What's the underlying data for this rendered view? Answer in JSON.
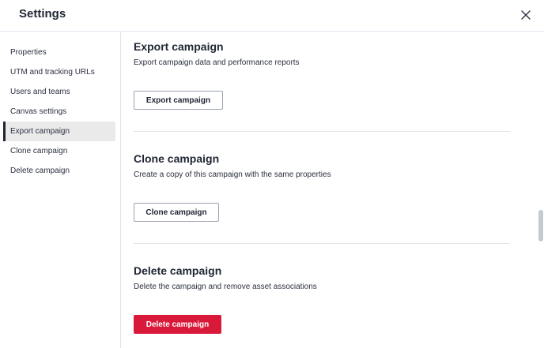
{
  "header": {
    "title": "Settings",
    "close_icon": "close-icon"
  },
  "sidebar": {
    "items": [
      {
        "label": "Properties",
        "active": false
      },
      {
        "label": "UTM and tracking URLs",
        "active": false
      },
      {
        "label": "Users and teams",
        "active": false
      },
      {
        "label": "Canvas settings",
        "active": false
      },
      {
        "label": "Export campaign",
        "active": true
      },
      {
        "label": "Clone campaign",
        "active": false
      },
      {
        "label": "Delete campaign",
        "active": false
      }
    ]
  },
  "sections": {
    "export": {
      "title": "Export campaign",
      "description": "Export campaign data and performance reports",
      "button_label": "Export campaign"
    },
    "clone": {
      "title": "Clone campaign",
      "description": "Create a copy of this campaign with the same properties",
      "button_label": "Clone campaign"
    },
    "delete": {
      "title": "Delete campaign",
      "description": "Delete the campaign and remove asset associations",
      "button_label": "Delete campaign"
    }
  },
  "colors": {
    "danger": "#d9193a",
    "active_bg": "#eaeaea",
    "border": "#dfe3eb"
  }
}
